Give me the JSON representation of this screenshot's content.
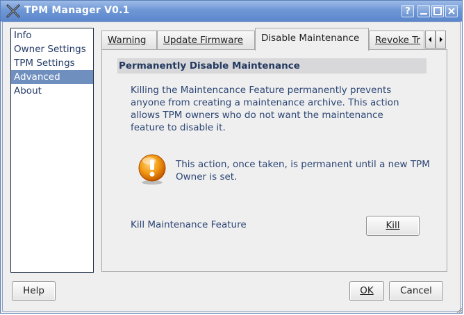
{
  "window": {
    "title": "TPM Manager V0.1",
    "controls": {
      "help": "?"
    }
  },
  "sidebar": {
    "items": [
      {
        "label": "Info",
        "selected": false
      },
      {
        "label": "Owner Settings",
        "selected": false
      },
      {
        "label": "TPM Settings",
        "selected": false
      },
      {
        "label": "Advanced",
        "selected": true
      },
      {
        "label": "About",
        "selected": false
      }
    ]
  },
  "tabs": {
    "items": [
      {
        "label": "Warning",
        "active": false
      },
      {
        "label": "Update Firmware",
        "active": false
      },
      {
        "label": "Disable Maintenance",
        "active": true
      },
      {
        "label": "Revoke Tr",
        "active": false
      }
    ]
  },
  "panel": {
    "heading": "Permanently Disable Maintenance",
    "description": "Killing the Maintencance Feature permanently prevents anyone from creating a maintenance archive. This action allows TPM owners who do not want the maintenance feature to disable it.",
    "warning": "This action, once taken, is permanent until a new TPM Owner is set.",
    "kill_label": "Kill Maintenance Feature",
    "kill_button": "Kill"
  },
  "footer": {
    "help": "Help",
    "ok": "OK",
    "cancel": "Cancel"
  },
  "colors": {
    "titlebar": "#6f97d6",
    "selection": "#6f8fbf",
    "text": "#2b4574",
    "warning_icon": "#f08a00"
  }
}
